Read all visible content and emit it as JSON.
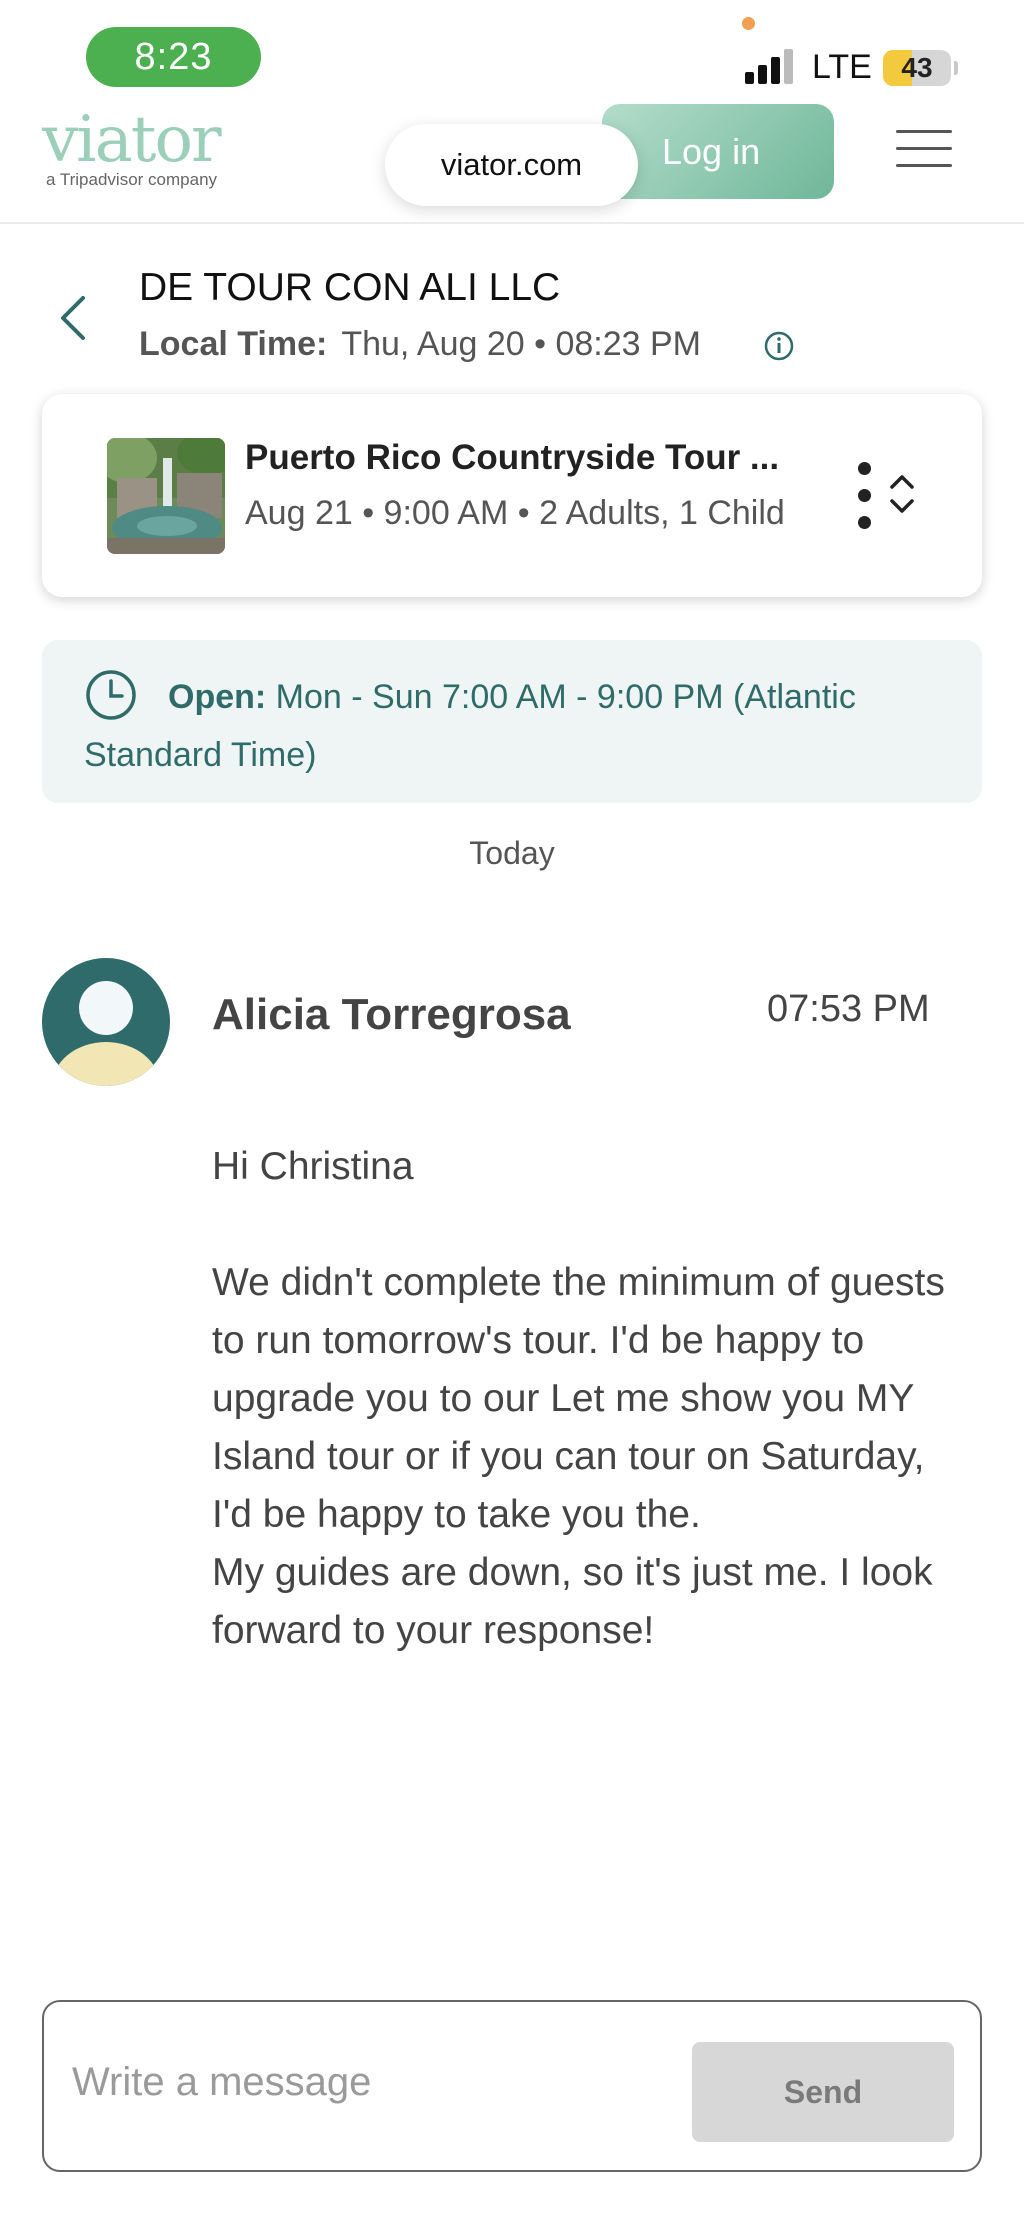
{
  "status_bar": {
    "time": "8:23",
    "network": "LTE",
    "battery_level": "43",
    "battery_fraction": 0.43
  },
  "header": {
    "logo": "viator",
    "logo_subtitle": "a Tripadvisor company",
    "url": "viator.com",
    "login_label": "Log in",
    "icons": [
      "menu-icon"
    ]
  },
  "operator": {
    "name": "DE TOUR CON ALI LLC",
    "local_time_label": "Local Time:",
    "local_time_value": "Thu, Aug 20 • 08:23 PM"
  },
  "booking": {
    "title": "Puerto Rico Countryside Tour ...",
    "details": "Aug 21 • 9:00 AM • 2 Adults, 1 Child"
  },
  "hours": {
    "label": "Open:",
    "text": "Mon - Sun 7:00 AM - 9:00 PM (Atlantic Standard Time)"
  },
  "day_separator": "Today",
  "message": {
    "sender": "Alicia Torregrosa",
    "time": "07:53 PM",
    "body": "Hi Christina\n\nWe didn't complete the minimum of guests to run tomorrow's tour. I'd be happy to upgrade you to our Let me show you MY Island tour or if you can tour on Saturday,  I'd be happy to take you the.\nMy guides are down, so it's just me. I look forward to your response!"
  },
  "composer": {
    "placeholder": "Write a message",
    "value": "",
    "send_label": "Send"
  },
  "colors": {
    "accent_green": "#6fb79a",
    "logo_green": "#9ccfb9",
    "teal_text": "#2f6b68",
    "hours_bg": "#eef5f4",
    "avatar_bg": "#2f6b6b",
    "avatar_body": "#f3e6b5"
  }
}
